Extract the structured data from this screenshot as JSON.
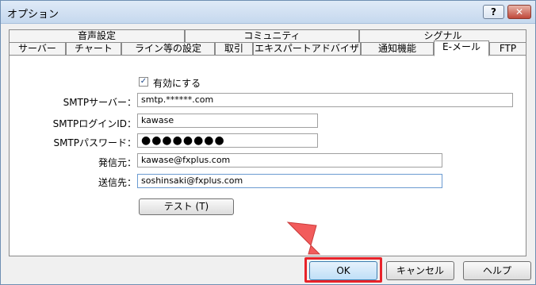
{
  "window": {
    "title": "オプション",
    "help_button": "?",
    "close_button": "✕"
  },
  "tabs_row1": [
    "音声設定",
    "コミュニティ",
    "シグナル"
  ],
  "tabs_row2": [
    "サーバー",
    "チャート",
    "ライン等の設定",
    "取引",
    "エキスパートアドバイザ",
    "通知機能",
    "E-メール",
    "FTP"
  ],
  "active_tab": "E-メール",
  "form": {
    "enable_label": "有効にする",
    "enabled": true,
    "smtp_server_label": "SMTPサーバー：",
    "smtp_server_value": "smtp.******.com",
    "smtp_login_label": "SMTPログインID：",
    "smtp_login_value": "kawase",
    "smtp_password_label": "SMTPパスワード：",
    "smtp_password_value": "●●●●●●●●",
    "from_label": "発信元：",
    "from_value": "kawase@fxplus.com",
    "to_label": "送信先：",
    "to_value": "soshinsaki@fxplus.com",
    "test_button": "テスト (T)"
  },
  "footer": {
    "ok": "OK",
    "cancel": "キャンセル",
    "help": "ヘルプ"
  },
  "colors": {
    "highlight": "#e8232a",
    "arrow": "#f25c5c"
  }
}
